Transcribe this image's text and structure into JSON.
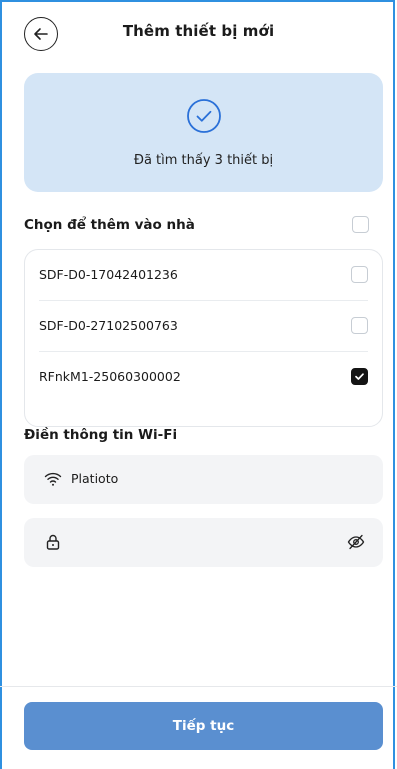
{
  "header": {
    "title": "Thêm thiết bị mới"
  },
  "found": {
    "text": "Đã tìm thấy 3 thiết bị"
  },
  "select": {
    "title": "Chọn để thêm vào nhà",
    "select_all_checked": false,
    "devices": [
      {
        "label": "SDF-D0-17042401236",
        "checked": false
      },
      {
        "label": "SDF-D0-27102500763",
        "checked": false
      },
      {
        "label": "RFnkM1-25060300002",
        "checked": true
      }
    ]
  },
  "wifi": {
    "title": "Điền thông tin Wi-Fi",
    "ssid_value": "Platioto",
    "password_value": ""
  },
  "footer": {
    "continue_label": "Tiếp tục"
  },
  "colors": {
    "accent": "#2f90e0",
    "card_bg": "#d4e5f6",
    "button_bg": "#5a8fd0"
  }
}
